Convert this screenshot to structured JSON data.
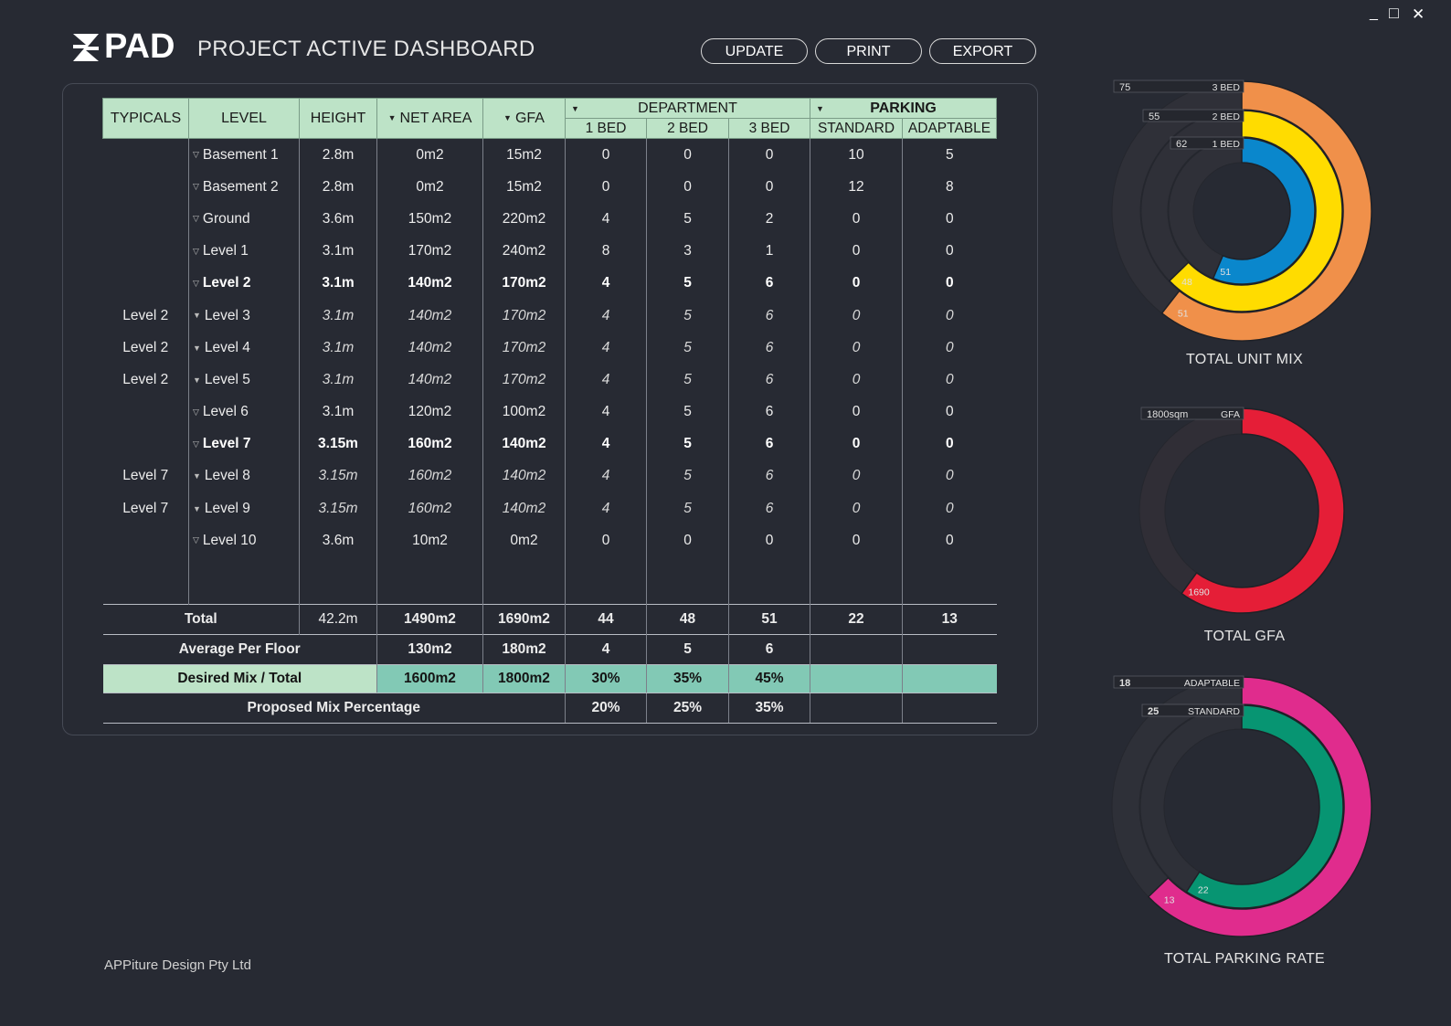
{
  "window": {
    "minimize": "_",
    "maximize": "□",
    "close": "✕"
  },
  "header": {
    "logo": "PAD",
    "title": "PROJECT ACTIVE DASHBOARD"
  },
  "toolbar": {
    "update": "UPDATE",
    "print": "PRINT",
    "export": "EXPORT"
  },
  "table": {
    "headers": {
      "typicals": "TYPICALS",
      "level": "LEVEL",
      "height": "HEIGHT",
      "net_area": "NET AREA",
      "gfa": "GFA",
      "department": "DEPARTMENT",
      "parking": "PARKING",
      "bed1": "1 BED",
      "bed2": "2 BED",
      "bed3": "3 BED",
      "standard": "STANDARD",
      "adaptable": "ADAPTABLE"
    },
    "rows": [
      {
        "typ": "",
        "level": "Basement 1",
        "height": "2.8m",
        "net": "0m2",
        "gfa": "15m2",
        "b1": "0",
        "b2": "0",
        "b3": "0",
        "std": "10",
        "adp": "5",
        "style": "normal",
        "arrow": "▽"
      },
      {
        "typ": "",
        "level": "Basement 2",
        "height": "2.8m",
        "net": "0m2",
        "gfa": "15m2",
        "b1": "0",
        "b2": "0",
        "b3": "0",
        "std": "12",
        "adp": "8",
        "style": "normal",
        "arrow": "▽"
      },
      {
        "typ": "",
        "level": "Ground",
        "height": "3.6m",
        "net": "150m2",
        "gfa": "220m2",
        "b1": "4",
        "b2": "5",
        "b3": "2",
        "std": "0",
        "adp": "0",
        "style": "normal",
        "arrow": "▽"
      },
      {
        "typ": "",
        "level": "Level 1",
        "height": "3.1m",
        "net": "170m2",
        "gfa": "240m2",
        "b1": "8",
        "b2": "3",
        "b3": "1",
        "std": "0",
        "adp": "0",
        "style": "normal",
        "arrow": "▽"
      },
      {
        "typ": "",
        "level": "Level 2",
        "height": "3.1m",
        "net": "140m2",
        "gfa": "170m2",
        "b1": "4",
        "b2": "5",
        "b3": "6",
        "std": "0",
        "adp": "0",
        "style": "bold",
        "arrow": "▽"
      },
      {
        "typ": "Level 2",
        "level": "Level 3",
        "height": "3.1m",
        "net": "140m2",
        "gfa": "170m2",
        "b1": "4",
        "b2": "5",
        "b3": "6",
        "std": "0",
        "adp": "0",
        "style": "it",
        "arrow": "▼"
      },
      {
        "typ": "Level 2",
        "level": "Level 4",
        "height": "3.1m",
        "net": "140m2",
        "gfa": "170m2",
        "b1": "4",
        "b2": "5",
        "b3": "6",
        "std": "0",
        "adp": "0",
        "style": "it",
        "arrow": "▼"
      },
      {
        "typ": "Level 2",
        "level": "Level 5",
        "height": "3.1m",
        "net": "140m2",
        "gfa": "170m2",
        "b1": "4",
        "b2": "5",
        "b3": "6",
        "std": "0",
        "adp": "0",
        "style": "it",
        "arrow": "▼"
      },
      {
        "typ": "",
        "level": "Level 6",
        "height": "3.1m",
        "net": "120m2",
        "gfa": "100m2",
        "b1": "4",
        "b2": "5",
        "b3": "6",
        "std": "0",
        "adp": "0",
        "style": "normal",
        "arrow": "▽"
      },
      {
        "typ": "",
        "level": "Level 7",
        "height": "3.15m",
        "net": "160m2",
        "gfa": "140m2",
        "b1": "4",
        "b2": "5",
        "b3": "6",
        "std": "0",
        "adp": "0",
        "style": "bold",
        "arrow": "▽"
      },
      {
        "typ": "Level 7",
        "level": "Level 8",
        "height": "3.15m",
        "net": "160m2",
        "gfa": "140m2",
        "b1": "4",
        "b2": "5",
        "b3": "6",
        "std": "0",
        "adp": "0",
        "style": "it",
        "arrow": "▼"
      },
      {
        "typ": "Level 7",
        "level": "Level 9",
        "height": "3.15m",
        "net": "160m2",
        "gfa": "140m2",
        "b1": "4",
        "b2": "5",
        "b3": "6",
        "std": "0",
        "adp": "0",
        "style": "it",
        "arrow": "▼"
      },
      {
        "typ": "",
        "level": "Level 10",
        "height": "3.6m",
        "net": "10m2",
        "gfa": "0m2",
        "b1": "0",
        "b2": "0",
        "b3": "0",
        "std": "0",
        "adp": "0",
        "style": "normal",
        "arrow": "▽"
      }
    ],
    "total": {
      "label": "Total",
      "height": "42.2m",
      "net": "1490m2",
      "gfa": "1690m2",
      "b1": "44",
      "b2": "48",
      "b3": "51",
      "std": "22",
      "adp": "13"
    },
    "average": {
      "label": "Average Per Floor",
      "net": "130m2",
      "gfa": "180m2",
      "b1": "4",
      "b2": "5",
      "b3": "6"
    },
    "desired": {
      "label": "Desired Mix / Total",
      "net": "1600m2",
      "gfa": "1800m2",
      "b1": "30%",
      "b2": "35%",
      "b3": "45%"
    },
    "proposed": {
      "label": "Proposed Mix Percentage",
      "b1": "20%",
      "b2": "25%",
      "b3": "35%"
    }
  },
  "chart_data": [
    {
      "type": "donut",
      "title": "TOTAL UNIT MIX",
      "series": [
        {
          "name": "3 BED",
          "target": "75",
          "actual": "51",
          "color": "#f0904a"
        },
        {
          "name": "2 BED",
          "target": "55",
          "actual": "48",
          "color": "#ffdc00"
        },
        {
          "name": "1 BED",
          "target": "62",
          "actual": "51",
          "color": "#0a87cc"
        }
      ]
    },
    {
      "type": "donut",
      "title": "TOTAL GFA",
      "series": [
        {
          "name": "GFA",
          "target": "1800sqm",
          "actual": "1690",
          "color": "#e51e37"
        }
      ]
    },
    {
      "type": "donut",
      "title": "TOTAL PARKING RATE",
      "series": [
        {
          "name": "ADAPTABLE",
          "target": "18",
          "actual": "13",
          "color": "#e02c8d"
        },
        {
          "name": "STANDARD",
          "target": "25",
          "actual": "22",
          "color": "#079572"
        }
      ]
    }
  ],
  "footer": {
    "company": "APPiture Design Pty Ltd"
  }
}
